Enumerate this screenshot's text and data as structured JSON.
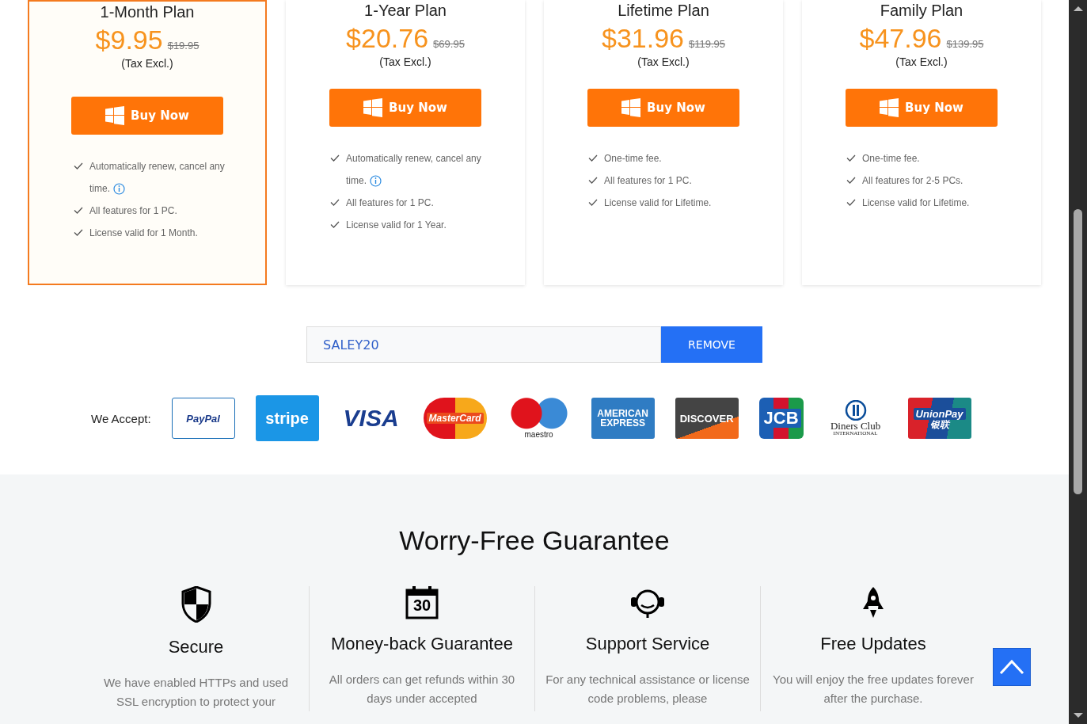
{
  "plans": [
    {
      "title": "1-Month Plan",
      "price": "$9.95",
      "old_price": "$19.95",
      "tax": "(Tax Excl.)",
      "button": "Buy Now",
      "selected": true,
      "features": [
        {
          "text": "Automatically renew, cancel any time.",
          "info": true
        },
        {
          "text": "All features for 1 PC.",
          "info": false
        },
        {
          "text": "License valid for 1 Month.",
          "info": false
        }
      ]
    },
    {
      "title": "1-Year Plan",
      "price": "$20.76",
      "old_price": "$69.95",
      "tax": "(Tax Excl.)",
      "button": "Buy Now",
      "selected": false,
      "features": [
        {
          "text": "Automatically renew, cancel any time.",
          "info": true
        },
        {
          "text": "All features for 1 PC.",
          "info": false
        },
        {
          "text": "License valid for 1 Year.",
          "info": false
        }
      ]
    },
    {
      "title": "Lifetime Plan",
      "price": "$31.96",
      "old_price": "$119.95",
      "tax": "(Tax Excl.)",
      "button": "Buy Now",
      "selected": false,
      "features": [
        {
          "text": "One-time fee.",
          "info": false
        },
        {
          "text": "All features for 1 PC.",
          "info": false
        },
        {
          "text": "License valid for Lifetime.",
          "info": false
        }
      ]
    },
    {
      "title": "Family Plan",
      "price": "$47.96",
      "old_price": "$139.95",
      "tax": "(Tax Excl.)",
      "button": "Buy Now",
      "selected": false,
      "features": [
        {
          "text": "One-time fee.",
          "info": false
        },
        {
          "text": "All features for 2-5 PCs.",
          "info": false
        },
        {
          "text": "License valid for Lifetime.",
          "info": false
        }
      ]
    }
  ],
  "coupon": {
    "value": "SALEY20",
    "button": "REMOVE"
  },
  "payments": {
    "label": "We Accept:",
    "methods": [
      {
        "kind": "paypal",
        "text": "PayPal"
      },
      {
        "kind": "stripe",
        "text": "stripe"
      },
      {
        "kind": "visa",
        "text": "VISA"
      },
      {
        "kind": "mastercard",
        "text": "MasterCard"
      },
      {
        "kind": "maestro",
        "text": "maestro"
      },
      {
        "kind": "amex",
        "text": "AMERICAN EXPRESS"
      },
      {
        "kind": "discover",
        "text": "DISCOVER"
      },
      {
        "kind": "jcb",
        "text": "JCB"
      },
      {
        "kind": "diners",
        "text": "Diners Club",
        "subtext": "INTERNATIONAL"
      },
      {
        "kind": "unionpay",
        "text": "UnionPay",
        "subtext": "银联"
      }
    ]
  },
  "guarantee": {
    "title": "Worry-Free Guarantee",
    "items": [
      {
        "kind": "shield",
        "title": "Secure",
        "text": "We have enabled HTTPs and used SSL encryption to protect your"
      },
      {
        "kind": "calendar",
        "title": "Money-back Guarantee",
        "text": "All orders can get refunds within 30 days under accepted",
        "icon_text": "30"
      },
      {
        "kind": "headset",
        "title": "Support Service",
        "text": "For any technical assistance or license code problems, please"
      },
      {
        "kind": "rocket",
        "title": "Free Updates",
        "text": "You will enjoy the free updates forever after the purchase."
      }
    ]
  }
}
